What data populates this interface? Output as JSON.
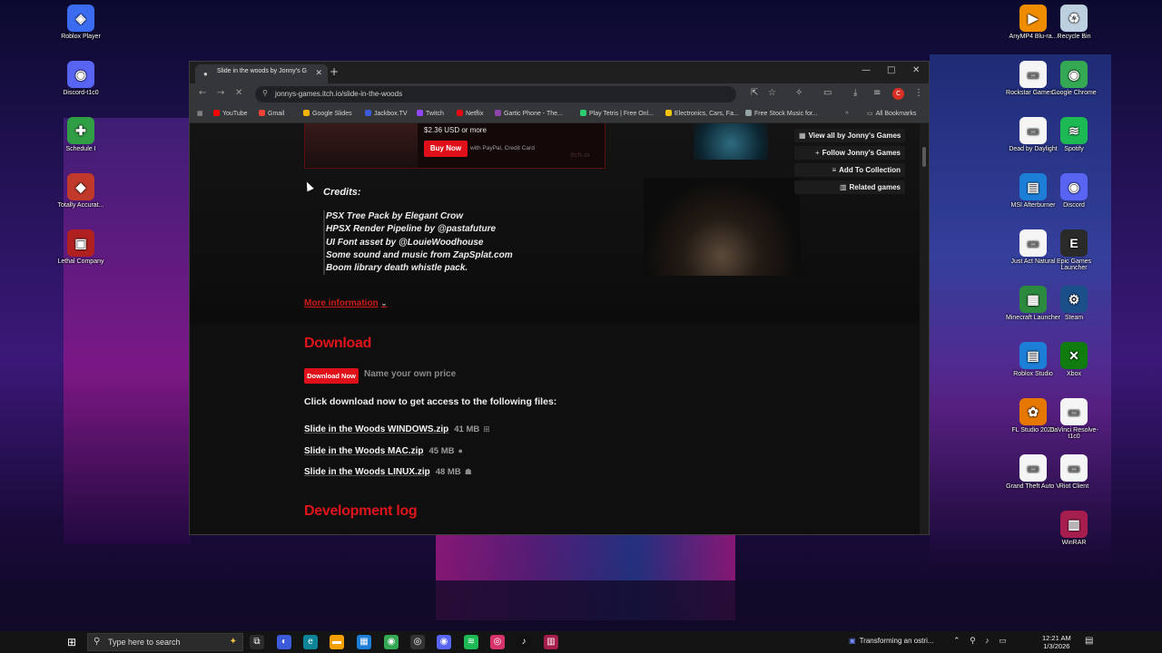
{
  "browser": {
    "tab_title": "Slide in the woods by Jonny's G",
    "url": "jonnys-games.itch.io/slide-in-the-woods",
    "profile_initial": "C",
    "bookmarks": [
      {
        "label": "YouTube",
        "color": "#ff0000"
      },
      {
        "label": "Gmail",
        "color": "#ea4335"
      },
      {
        "label": "Google Slides",
        "color": "#f4b400"
      },
      {
        "label": "Jackbox.TV",
        "color": "#3b5bdb"
      },
      {
        "label": "Twitch",
        "color": "#9146ff"
      },
      {
        "label": "Netflix",
        "color": "#e50914"
      },
      {
        "label": "Gartic Phone - The...",
        "color": "#8e44ad"
      },
      {
        "label": "Play Tetris | Free Onl...",
        "color": "#2ecc71"
      },
      {
        "label": "Electronics, Cars, Fa...",
        "color": "#f1c40f"
      },
      {
        "label": "Free Stock Music for...",
        "color": "#95a5a6"
      }
    ],
    "all_bookmarks": "All Bookmarks"
  },
  "page": {
    "price_text": "$2.36 USD or more",
    "buy_now": "Buy Now",
    "pay_with": "with PayPal, Credit Card",
    "watermark": "itch.io",
    "actions": [
      {
        "label": "View all by Jonny's Games",
        "icon": "grid-icon",
        "glyph": "▦"
      },
      {
        "label": "Follow Jonny's Games",
        "icon": "follow-icon",
        "glyph": "+"
      },
      {
        "label": "Add To Collection",
        "icon": "collection-icon",
        "glyph": "≡"
      },
      {
        "label": "Related games",
        "icon": "related-icon",
        "glyph": "▥"
      }
    ],
    "credits_title": "Credits:",
    "credits": [
      "PSX Tree Pack by Elegant Crow",
      "HPSX Render Pipeline by @pastafuture",
      "UI Font asset by @LouieWoodhouse",
      "Some sound and music from ZapSplat.com",
      "Boom library death whistle pack."
    ],
    "more_information": "More information",
    "download_heading": "Download",
    "download_now": "Download Now",
    "name_your_price": "Name your own price",
    "download_info": "Click download now to get access to the following files:",
    "files": [
      {
        "name": "Slide in the Woods WINDOWS.zip",
        "size": "41 MB",
        "os_icon": "windows-icon",
        "glyph": "⊞"
      },
      {
        "name": "Slide in the Woods MAC.zip",
        "size": "45 MB",
        "os_icon": "apple-icon",
        "glyph": "●"
      },
      {
        "name": "Slide in the Woods LINUX.zip",
        "size": "48 MB",
        "os_icon": "linux-icon",
        "glyph": "☗"
      }
    ],
    "devlog_heading": "Development log"
  },
  "desktop": {
    "left_icons": [
      {
        "label": "Roblox Player",
        "color": "#3b6cf0",
        "glyph": "◈"
      },
      {
        "label": "Discord-t1c0",
        "color": "#5865f2",
        "glyph": "◉"
      },
      {
        "label": "Schedule I",
        "color": "#2f9e44",
        "glyph": "✚"
      },
      {
        "label": "Totally Accurat...",
        "color": "#c0392b",
        "glyph": "◆"
      },
      {
        "label": "Lethal Company",
        "color": "#b02020",
        "glyph": "▣"
      }
    ],
    "right_icons_col1": [
      {
        "label": "AnyMP4 Blu-ra...",
        "color": "#f08c00",
        "glyph": "▶"
      },
      {
        "label": "Rockstar Games ...",
        "color": "#f5f5f5",
        "glyph": "▭"
      },
      {
        "label": "Dead by Daylight",
        "color": "#f5f5f5",
        "glyph": "▭"
      },
      {
        "label": "MSI Afterburner",
        "color": "#1c7ed6",
        "glyph": "▤"
      },
      {
        "label": "Just Act Natural",
        "color": "#f5f5f5",
        "glyph": "▭"
      },
      {
        "label": "Minecraft Launcher",
        "color": "#2b8a3e",
        "glyph": "▦"
      },
      {
        "label": "Roblox Studio",
        "color": "#1c7ed6",
        "glyph": "▤"
      },
      {
        "label": "FL Studio 2025",
        "color": "#e67700",
        "glyph": "✿"
      },
      {
        "label": "Grand Theft Auto V",
        "color": "#f5f5f5",
        "glyph": "▭"
      }
    ],
    "right_icons_col2": [
      {
        "label": "Recycle Bin",
        "color": "#bcd0e0",
        "glyph": "♻"
      },
      {
        "label": "Google Chrome",
        "color": "#34a853",
        "glyph": "◉"
      },
      {
        "label": "Spotify",
        "color": "#1db954",
        "glyph": "≋"
      },
      {
        "label": "Discord",
        "color": "#5865f2",
        "glyph": "◉"
      },
      {
        "label": "Epic Games Launcher",
        "color": "#2a2a2a",
        "glyph": "E"
      },
      {
        "label": "Steam",
        "color": "#1b4f8a",
        "glyph": "⚙"
      },
      {
        "label": "Xbox",
        "color": "#107c10",
        "glyph": "✕"
      },
      {
        "label": "DaVinci Resolve-t1c0",
        "color": "#f5f5f5",
        "glyph": "▭"
      },
      {
        "label": "Riot Client",
        "color": "#f5f5f5",
        "glyph": "▭"
      },
      {
        "label": "WinRAR",
        "color": "#a61e4d",
        "glyph": "▥"
      }
    ]
  },
  "taskbar": {
    "search_placeholder": "Type here to search",
    "apps": [
      {
        "name": "task-view-icon",
        "color": "#2b2b2b",
        "glyph": "⧉"
      },
      {
        "name": "copilot-icon",
        "color": "#3b5bdb",
        "glyph": "◐"
      },
      {
        "name": "edge-icon",
        "color": "#0c8599",
        "glyph": "e"
      },
      {
        "name": "file-explorer-icon",
        "color": "#f59f00",
        "glyph": "▬"
      },
      {
        "name": "store-icon",
        "color": "#1c7ed6",
        "glyph": "▦"
      },
      {
        "name": "chrome-icon",
        "color": "#34a853",
        "glyph": "◉"
      },
      {
        "name": "github-icon",
        "color": "#333333",
        "glyph": "◎"
      },
      {
        "name": "discord-icon",
        "color": "#5865f2",
        "glyph": "◉"
      },
      {
        "name": "spotify-icon",
        "color": "#1db954",
        "glyph": "≋"
      },
      {
        "name": "instagram-icon",
        "color": "#d6336c",
        "glyph": "◎"
      },
      {
        "name": "tiktok-icon",
        "color": "#111111",
        "glyph": "♪"
      },
      {
        "name": "winrar-icon",
        "color": "#a61e4d",
        "glyph": "▥"
      }
    ],
    "news_text": "Transforming an ostri...",
    "time": "12:21 AM",
    "date": "1/3/2026"
  }
}
